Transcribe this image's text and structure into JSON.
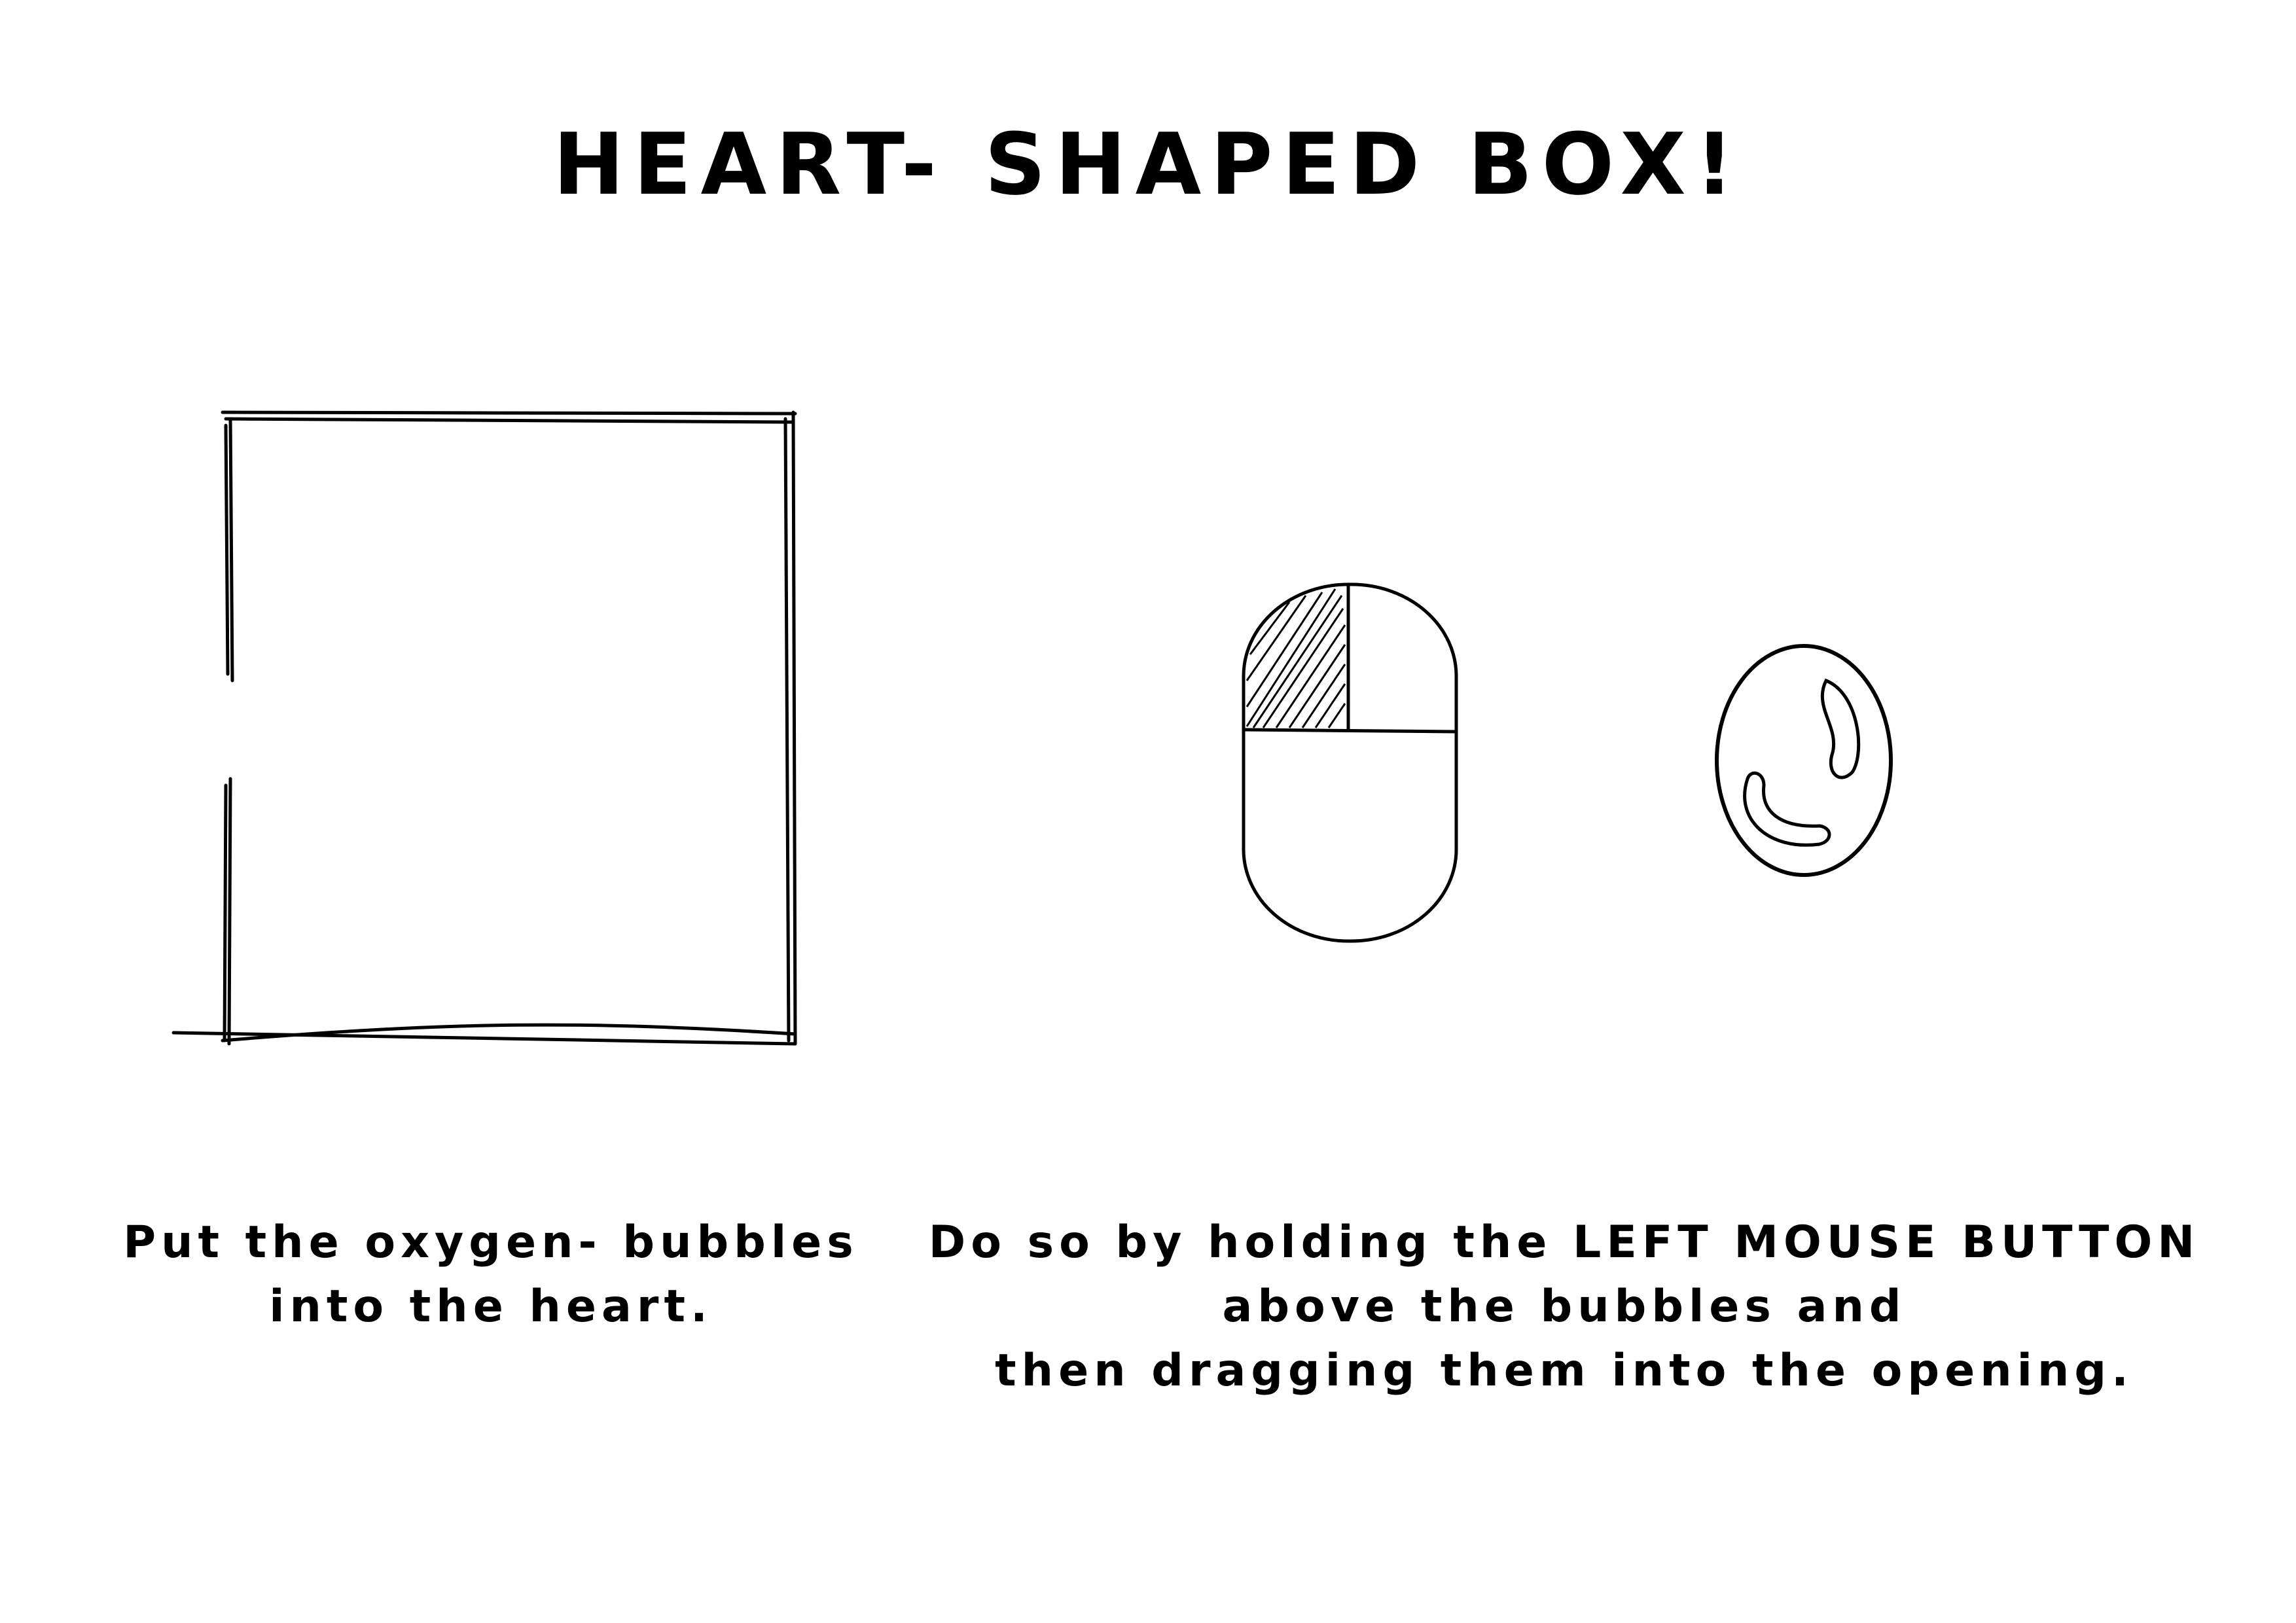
{
  "title": "HEART- SHAPED BOX!",
  "instructions": {
    "left": [
      "Put the oxygen- bubbles",
      "into the heart."
    ],
    "right": [
      "Do so by holding the LEFT MOUSE BUTTON",
      "above the bubbles and",
      "then dragging them into the opening."
    ]
  },
  "icons": {
    "box": "open-box-outline",
    "mouse": "mouse-left-button-icon",
    "bubble": "oxygen-bubble-icon"
  }
}
